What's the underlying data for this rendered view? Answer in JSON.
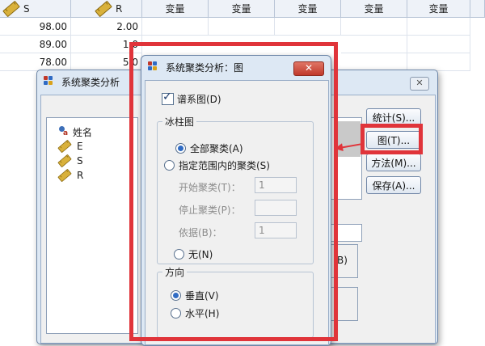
{
  "sheet": {
    "headers": [
      "S",
      "R",
      "变量",
      "变量",
      "变量",
      "变量",
      "变量",
      "变量"
    ],
    "rows": [
      [
        "98.00",
        "2.00"
      ],
      [
        "89.00",
        "1.0"
      ],
      [
        "78.00",
        "5.0"
      ]
    ]
  },
  "main_dialog": {
    "title": "系统聚类分析",
    "close_label": "✕",
    "variables": [
      "姓名",
      "E",
      "S",
      "R"
    ],
    "buttons": {
      "stats": "统计(S)...",
      "plot": "图(T)...",
      "method": "方法(M)...",
      "save": "保存(A)..."
    },
    "partial_button": "B)"
  },
  "plot_dialog": {
    "title": "系统聚类分析：图",
    "close_label": "✕",
    "dendrogram_label": "谱系图(D)",
    "icicle_group": "冰柱图",
    "all_clusters": "全部聚类(A)",
    "range_clusters": "指定范围内的聚类(S)",
    "start_label": "开始聚类(T)：",
    "start_value": "1",
    "stop_label": "停止聚类(P)：",
    "stop_value": "",
    "by_label": "依据(B)：",
    "by_value": "1",
    "none_label": "无(N)",
    "orientation_group": "方向",
    "vertical": "垂直(V)",
    "horizontal": "水平(H)"
  },
  "colors": {
    "highlight": "#e0343a",
    "titlebar": "#dde8f4",
    "dialog_bg": "#f0f0f0"
  }
}
